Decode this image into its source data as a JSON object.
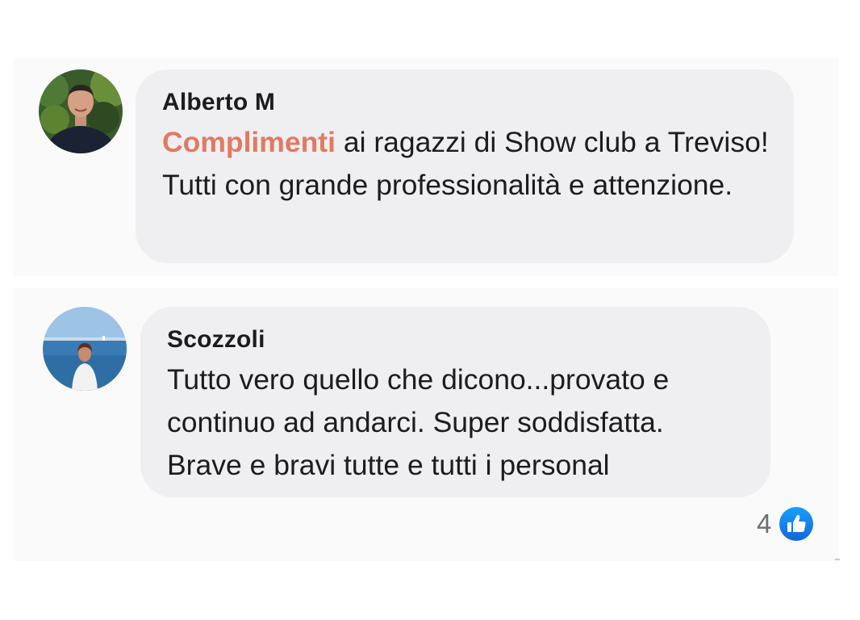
{
  "comments": [
    {
      "author": "Alberto M",
      "highlight": "Complimenti",
      "text": " ai ragazzi di Show club a Treviso! Tutti con grande professionalità e attenzione."
    },
    {
      "author": "Scozzoli",
      "text": "Tutto vero quello che dicono...provato e continuo ad andarci. Super soddisfatta. Brave e bravi tutte e tutti i personal"
    }
  ],
  "reactions": {
    "count": "4",
    "icon": "thumbs-up-icon",
    "color": "#1877f2"
  },
  "colors": {
    "highlight": "#e27a60",
    "bubble": "#efeff2"
  }
}
